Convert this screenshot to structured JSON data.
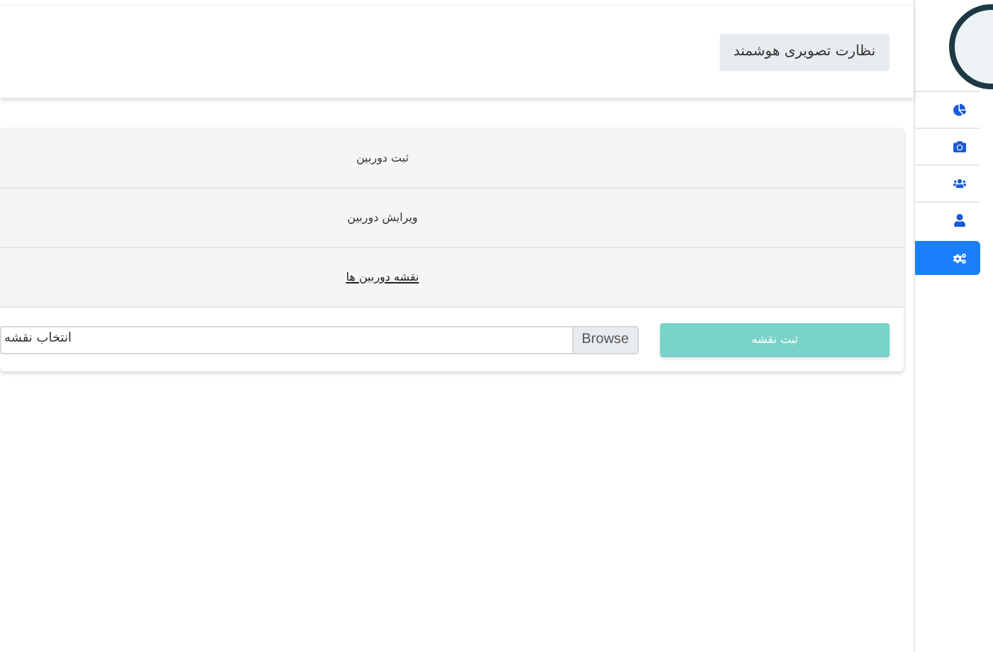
{
  "header": {
    "title_button": "نظارت تصویری هوشمند"
  },
  "sidebar": {
    "items": [
      {
        "kind": "chart",
        "selected": false
      },
      {
        "kind": "camera",
        "selected": false
      },
      {
        "kind": "people",
        "selected": false
      },
      {
        "kind": "user",
        "selected": false
      },
      {
        "kind": "cogs",
        "selected": true
      }
    ]
  },
  "card": {
    "rows": [
      {
        "label": "ثبت دوربین",
        "link": false
      },
      {
        "label": "ویرایش دوربین",
        "link": false
      },
      {
        "label": "نقشه دوربین ها",
        "link": true
      }
    ],
    "file_input": {
      "value": "انتخاب نقشه",
      "browse": "Browse"
    },
    "submit_button": "ثبت نقشه"
  }
}
